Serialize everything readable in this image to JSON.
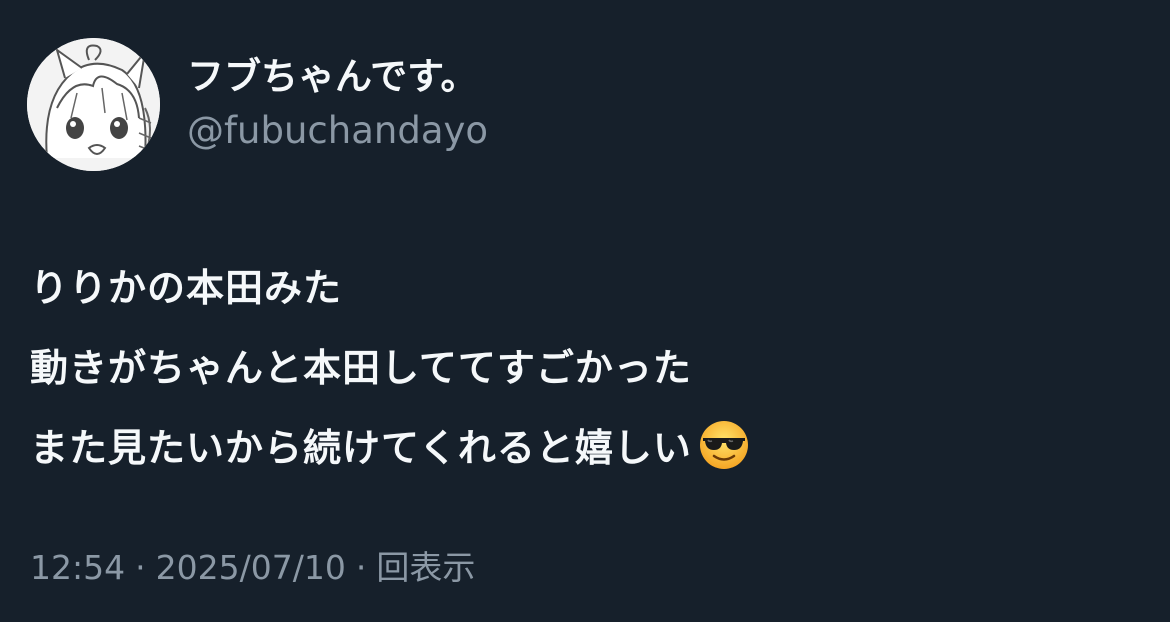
{
  "user": {
    "display_name": "フブちゃんです。",
    "handle": "@fubuchandayo",
    "avatar_icon": "avatar-icon"
  },
  "tweet": {
    "lines": [
      "りりかの本田みた",
      "動きがちゃんと本田しててすごかった",
      "また見たいから続けてくれると嬉しい"
    ],
    "emoji_icon": "smiling-face-with-sunglasses-icon"
  },
  "meta": {
    "time": "12:54",
    "date": "2025/07/10",
    "views": "回表示",
    "separator": "·"
  },
  "colors": {
    "background": "#16202b",
    "primary_text": "#f5f8fa",
    "secondary_text": "#8b98a5"
  }
}
